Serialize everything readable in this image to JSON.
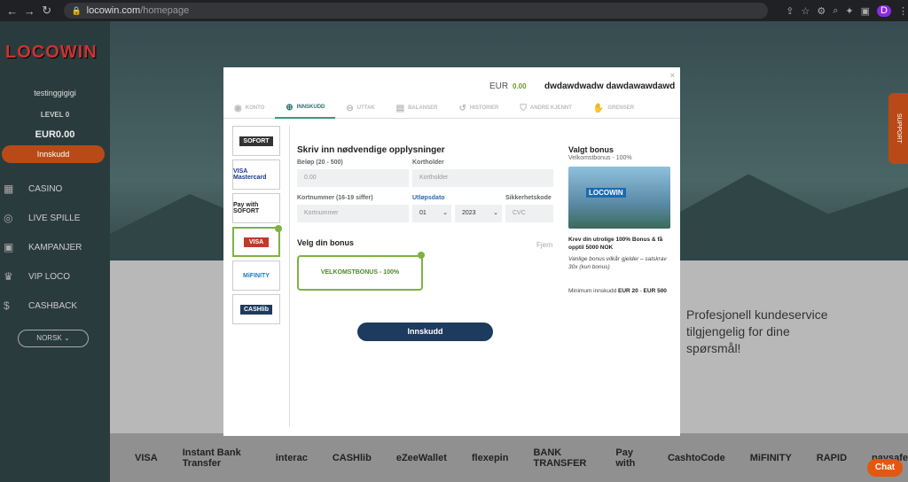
{
  "browser": {
    "domain": "locowin.com",
    "path": "/homepage"
  },
  "sidebar": {
    "logo": "LOCOWIN",
    "username": "testinggigigi",
    "level": "LEVEL 0",
    "balance": "EUR0.00",
    "deposit_label": "Innskudd",
    "items": [
      {
        "label": "CASINO",
        "icon": "slot-icon"
      },
      {
        "label": "LIVE SPILLE",
        "icon": "chip-icon"
      },
      {
        "label": "KAMPANJER",
        "icon": "gift-icon"
      },
      {
        "label": "VIP LOCO",
        "icon": "crown-icon"
      },
      {
        "label": "CASHBACK",
        "icon": "money-bag-icon"
      }
    ],
    "language": "NORSK"
  },
  "background": {
    "support_text": "Profesjonell kundeservice tilgjengelig for dine spørsmål!",
    "support_tab": "SUPPORT",
    "payments": [
      "VISA",
      "Instant Bank Transfer",
      "interac",
      "CASHlib",
      "eZeeWallet",
      "flexepin",
      "BANK TRANSFER",
      "Pay with",
      "CashtoCode",
      "MiFINITY",
      "RAPID",
      "paysafe"
    ],
    "chat_label": "Chat"
  },
  "modal": {
    "currency": "EUR",
    "amount": "0.00",
    "username": "dwdawdwadw dawdawawdawd",
    "tabs": [
      {
        "label": "KONTO",
        "icon": "user-icon"
      },
      {
        "label": "INNSKUDD",
        "icon": "plus-circle-icon",
        "active": true
      },
      {
        "label": "UTTAK",
        "icon": "minus-circle-icon"
      },
      {
        "label": "BALANSER",
        "icon": "wallet-icon"
      },
      {
        "label": "HISTORIER",
        "icon": "history-icon"
      },
      {
        "label": "ANDRE KJENNT",
        "icon": "shield-icon"
      },
      {
        "label": "GRENSER",
        "icon": "hand-icon"
      }
    ],
    "methods": [
      {
        "label": "SOFORT",
        "selected": false
      },
      {
        "label": "VISA Mastercard",
        "selected": false
      },
      {
        "label": "Pay with SOFORT",
        "selected": false
      },
      {
        "label": "VISA",
        "selected": true
      },
      {
        "label": "MiFINITY",
        "selected": false
      },
      {
        "label": "CASHlib",
        "selected": false
      }
    ],
    "form": {
      "title": "Skriv inn nødvendige opplysninger",
      "amount_label": "Beløp (20 - 500)",
      "amount_value": "0.00",
      "holder_label": "Kortholder",
      "holder_placeholder": "Kortholder",
      "card_label": "Kortnummer (16-19 siffer)",
      "card_placeholder": "Kortnummer",
      "expiry_label": "Utløpsdato",
      "month": "01",
      "year": "2023",
      "cvc_label": "Sikkerhetskode",
      "cvc_placeholder": "CVC"
    },
    "bonus": {
      "title": "Velg din bonus",
      "remove": "Fjern",
      "option": "VELKOMSTBONUS - 100%"
    },
    "submit_label": "Innskudd",
    "right_panel": {
      "title": "Valgt bonus",
      "subtitle": "Velkomstbonus - 100%",
      "image_logo": "LOCOWIN",
      "description": "Krev din utrolige 100% Bonus & få opptil 5000 NOK",
      "terms": "Vanlige bonus vilkår gjelder – satskrav 30x (kun bonus)",
      "min_label": "Minimum innskudd",
      "min_value": "EUR 20",
      "max_value": "EUR 500"
    }
  }
}
